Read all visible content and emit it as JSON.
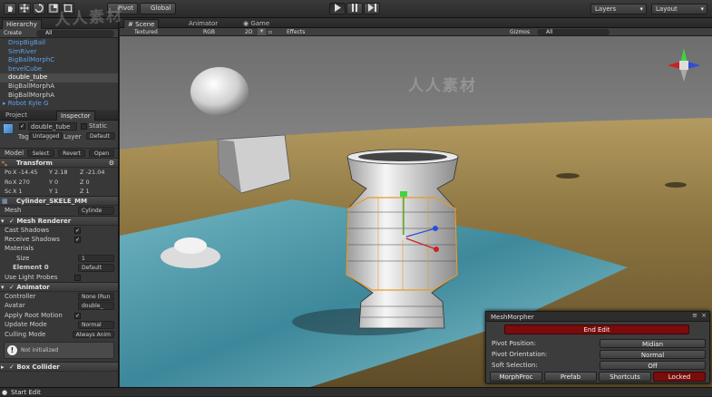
{
  "toolbar": {
    "pivot": "Pivot",
    "global": "Global",
    "layers": "Layers",
    "layout": "Layout"
  },
  "hierarchy": {
    "tab": "Hierarchy",
    "create": "Create",
    "search": "All",
    "items": [
      "DropBigBall",
      "SimRiver",
      "BigBallMorphC",
      "bevelCube",
      "double_tube",
      "BigBallMorphA",
      "BigBallMorphA",
      "Robot Kyle G"
    ]
  },
  "project_tab": "Project",
  "inspector": {
    "tab": "Inspector",
    "object_name": "double_tube",
    "static": "Static",
    "tag_label": "Tag",
    "tag_value": "Untagged",
    "layer_label": "Layer",
    "layer_value": "Default",
    "model_label": "Model",
    "model_buttons": [
      "Select",
      "Revert",
      "Open"
    ],
    "transform": {
      "title": "Transform",
      "rows": [
        {
          "label": "Po",
          "x": "X -14.45",
          "y": "Y 2.18",
          "z": "Z -21.04"
        },
        {
          "label": "Ro",
          "x": "X 270",
          "y": "Y 0",
          "z": "Z 0"
        },
        {
          "label": "Sc",
          "x": "X 1",
          "y": "Y 1",
          "z": "Z 1"
        }
      ]
    },
    "mesh_filter": {
      "title": "Cylinder_SKELE_MM",
      "mesh_label": "Mesh",
      "mesh_value": "Cylinde"
    },
    "mesh_renderer": {
      "title": "Mesh Renderer",
      "cast_shadows": "Cast Shadows",
      "receive_shadows": "Receive Shadows",
      "materials": "Materials",
      "size_label": "Size",
      "size_value": "1",
      "element_label": "Element 0",
      "element_value": "Default",
      "light_probes": "Use Light Probes"
    },
    "animator": {
      "title": "Animator",
      "controller_label": "Controller",
      "controller_value": "None (Run",
      "avatar_label": "Avatar",
      "avatar_value": "double_",
      "root_motion": "Apply Root Motion",
      "update_label": "Update Mode",
      "update_value": "Normal",
      "culling_label": "Culling Mode",
      "culling_value": "Always Anim",
      "not_initialized": "Not initialized"
    },
    "box_collider": {
      "title": "Box Collider"
    }
  },
  "scene": {
    "tab_scene": "Scene",
    "tab_animator": "Animator",
    "tab_game": "Game",
    "shading": "Textured",
    "rgb": "RGB",
    "mode_2d": "2D",
    "effects": "Effects",
    "gizmos": "Gizmos",
    "search": "All"
  },
  "mesh_morpher": {
    "title": "MeshMorpher",
    "end_edit": "End Edit",
    "pivot_position_label": "Pivot Position:",
    "pivot_position_value": "Midian",
    "pivot_orientation_label": "Pivot Orientation:",
    "pivot_orientation_value": "Normal",
    "soft_selection_label": "Soft Selection:",
    "soft_selection_value": "Off",
    "buttons": [
      "MorphProc",
      "Prefab",
      "Shortcuts",
      "Locked"
    ]
  },
  "status": {
    "text": "Start Edit"
  },
  "watermark": {
    "text": "人人素材"
  },
  "colors": {
    "accent_red": "#7a0c0c",
    "selection_orange": "#e89a2a"
  }
}
